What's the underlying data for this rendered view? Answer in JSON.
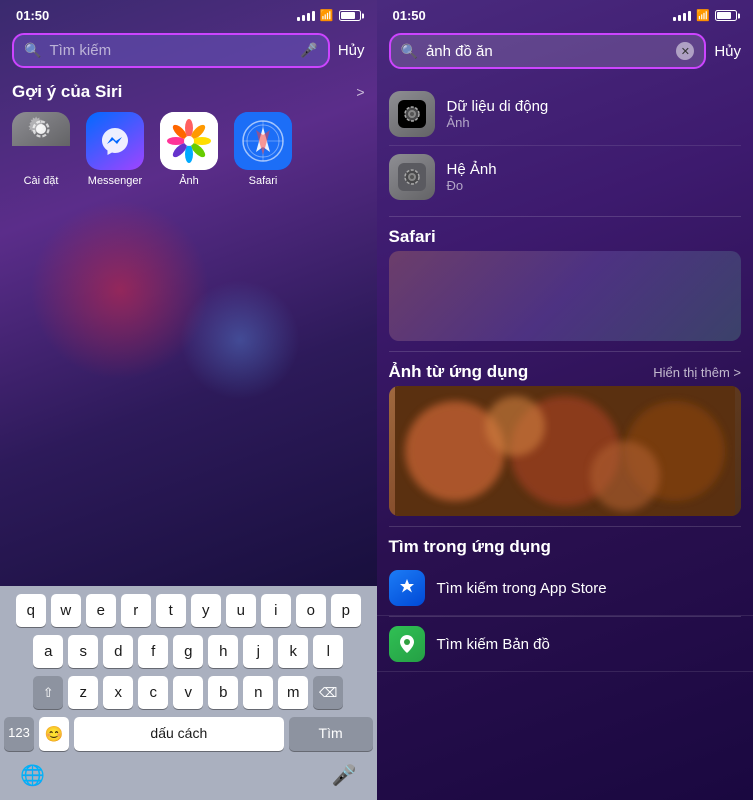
{
  "left_panel": {
    "status": {
      "time": "01:50",
      "signal": "...",
      "wifi": "wifi",
      "battery": "battery"
    },
    "search": {
      "placeholder": "Tìm kiếm",
      "cancel_label": "Hủy"
    },
    "siri": {
      "title": "Gợi ý của Siri",
      "more_label": ">",
      "apps": [
        {
          "label": "Cài đặt",
          "icon_type": "settings"
        },
        {
          "label": "Messenger",
          "icon_type": "messenger"
        },
        {
          "label": "Ảnh",
          "icon_type": "photos"
        },
        {
          "label": "Safari",
          "icon_type": "safari"
        }
      ]
    },
    "keyboard": {
      "rows": [
        [
          "q",
          "w",
          "e",
          "r",
          "t",
          "y",
          "u",
          "i",
          "o",
          "p"
        ],
        [
          "a",
          "s",
          "d",
          "f",
          "g",
          "h",
          "j",
          "k",
          "l"
        ],
        [
          "z",
          "x",
          "c",
          "v",
          "b",
          "n",
          "m"
        ]
      ],
      "space_label": "dấu cách",
      "send_label": "Tìm",
      "num_label": "123"
    }
  },
  "right_panel": {
    "status": {
      "time": "01:50",
      "signal": "...",
      "wifi": "wifi",
      "battery": "battery"
    },
    "search": {
      "value": "ảnh đồ ăn",
      "cancel_label": "Hủy"
    },
    "results": [
      {
        "name": "Dữ liệu di động",
        "sub": "Ảnh",
        "icon_type": "settings"
      },
      {
        "name": "Hệ Ảnh",
        "sub": "Đo",
        "icon_type": "settings"
      }
    ],
    "safari_section": {
      "title": "Safari",
      "more_label": ""
    },
    "photos_section": {
      "title": "Ảnh từ ứng dụng",
      "more_label": "Hiển thị thêm >"
    },
    "app_search_section": {
      "title": "Tìm trong ứng dụng",
      "items": [
        {
          "label": "Tìm kiếm trong App Store",
          "icon_type": "appstore"
        },
        {
          "label": "Tìm kiếm Bản đồ",
          "icon_type": "maps"
        }
      ]
    },
    "hien_thi_them": "Hiển thị thêm"
  }
}
